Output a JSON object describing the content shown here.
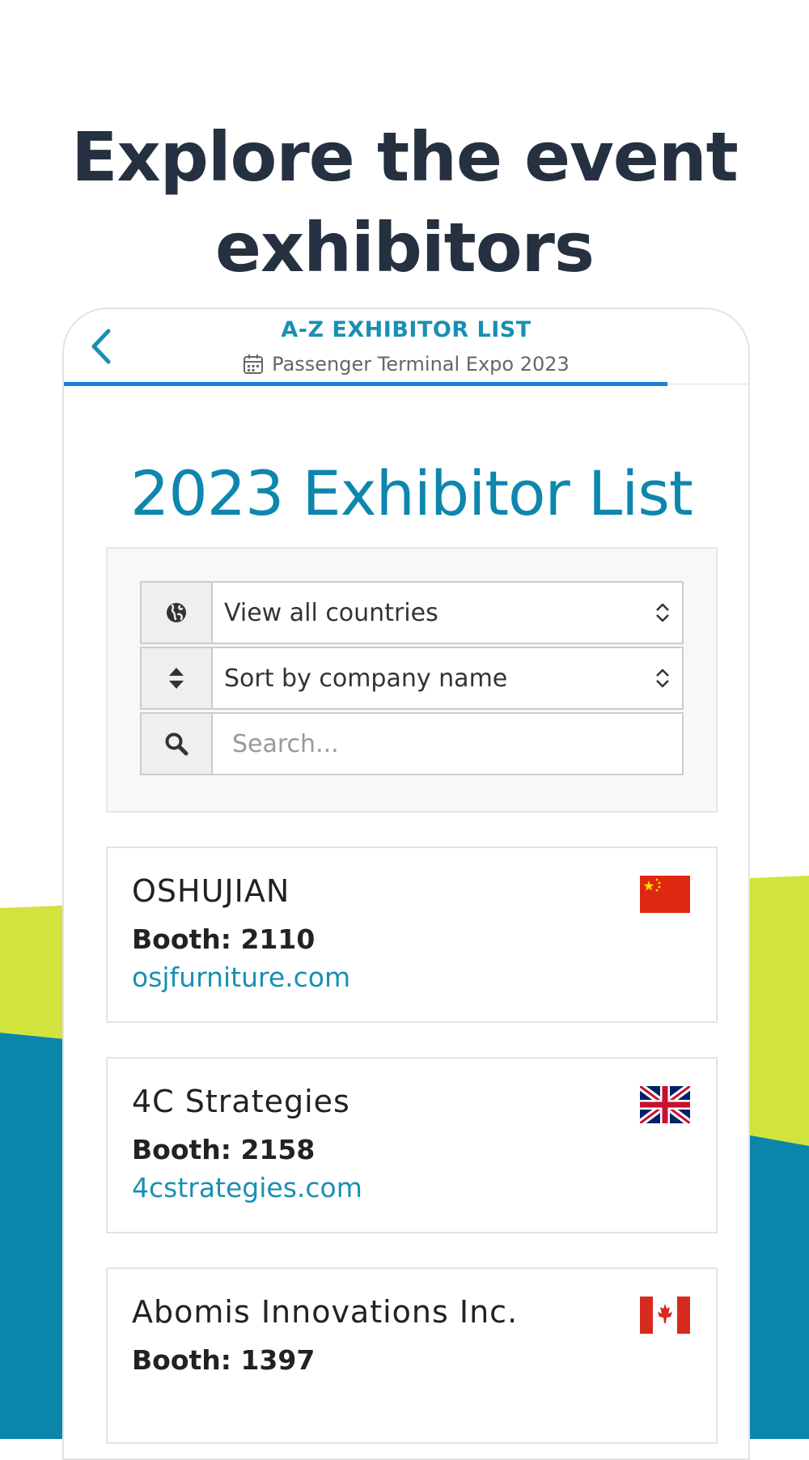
{
  "hero": {
    "title": "Explore the event exhibitors"
  },
  "header": {
    "title": "A-Z EXHIBITOR LIST",
    "subtitle": "Passenger Terminal Expo 2023"
  },
  "page": {
    "title": "2023 Exhibitor List"
  },
  "filters": {
    "country": {
      "value": "View all countries"
    },
    "sort": {
      "value": "Sort by company name"
    },
    "search": {
      "placeholder": "Search..."
    }
  },
  "exhibitors": [
    {
      "name": "OSHUJIAN",
      "booth": "Booth: 2110",
      "website": "osjfurniture.com",
      "flag": "china-flag"
    },
    {
      "name": "4C Strategies",
      "booth": "Booth: 2158",
      "website": "4cstrategies.com",
      "flag": "uk-flag"
    },
    {
      "name": "Abomis Innovations Inc.",
      "booth": "Booth: 1397",
      "website": "",
      "flag": "canada-flag"
    }
  ],
  "colors": {
    "accent": "#1a8fb3",
    "title_dark": "#253040",
    "wave_lime": "#d2e33e",
    "wave_blue": "#0b86ab",
    "progress": "#1e7fd6"
  }
}
